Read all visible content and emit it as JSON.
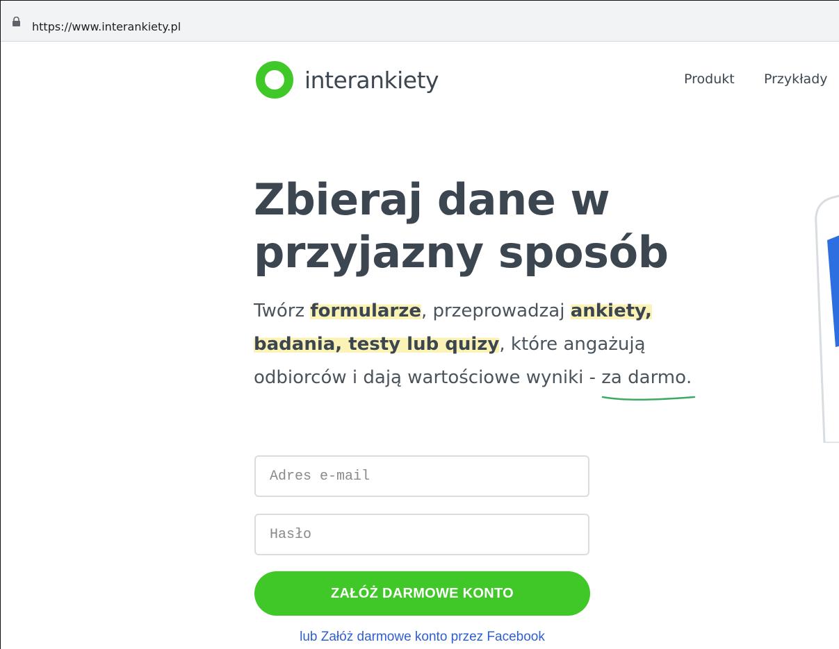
{
  "browser": {
    "url": "https://www.interankiety.pl"
  },
  "header": {
    "logo_text": "interankiety",
    "nav": [
      {
        "label": "Produkt"
      },
      {
        "label": "Przykłady"
      }
    ]
  },
  "hero": {
    "title_line1": "Zbieraj dane w",
    "title_line2": "przyjazny sposób",
    "lead": {
      "p1": "Twórz ",
      "hl1": "formularze",
      "p2": ", przeprowadzaj ",
      "hl2": "ankiety,",
      "hl3": "badania, testy lub quizy",
      "p3": ", które angażują odbiorców i dają wartościowe wyniki - ",
      "underlined": "za darmo",
      "end": "."
    }
  },
  "signup": {
    "email_placeholder": "Adres e-mail",
    "password_placeholder": "Hasło",
    "submit_label": "ZAŁÓŻ DARMOWE KONTO",
    "facebook_link": "lub Załóż darmowe konto przez Facebook"
  },
  "colors": {
    "brand_green": "#40c828",
    "highlight": "#fbf3b6",
    "link_blue": "#2f5fcf",
    "text_dark": "#3c4650"
  }
}
